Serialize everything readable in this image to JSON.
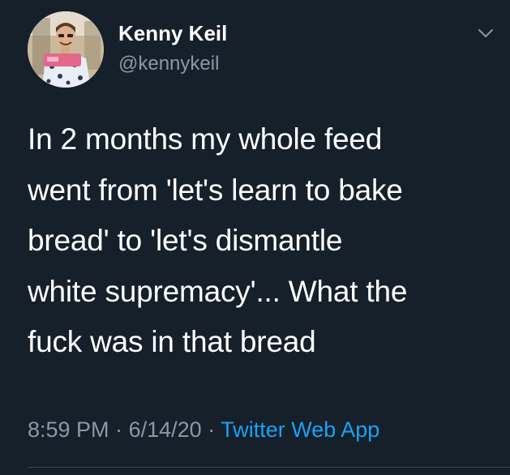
{
  "tweet": {
    "author": {
      "display_name": "Kenny Keil",
      "handle": "@kennykeil",
      "avatar_icon": "profile-photo"
    },
    "text_lines": [
      "In 2 months my whole feed",
      "went from 'let's learn to bake",
      "bread' to 'let's dismantle",
      "white supremacy'... What the",
      "fuck was in that bread"
    ],
    "time": "8:59 PM",
    "separator": "·",
    "date": "6/14/20",
    "source": "Twitter Web App",
    "menu_icon": "chevron-down-icon"
  },
  "colors": {
    "background": "#15202b",
    "primary_text": "#ffffff",
    "secondary_text": "#8899a6",
    "link": "#1da1f2",
    "divider": "#38444d"
  }
}
